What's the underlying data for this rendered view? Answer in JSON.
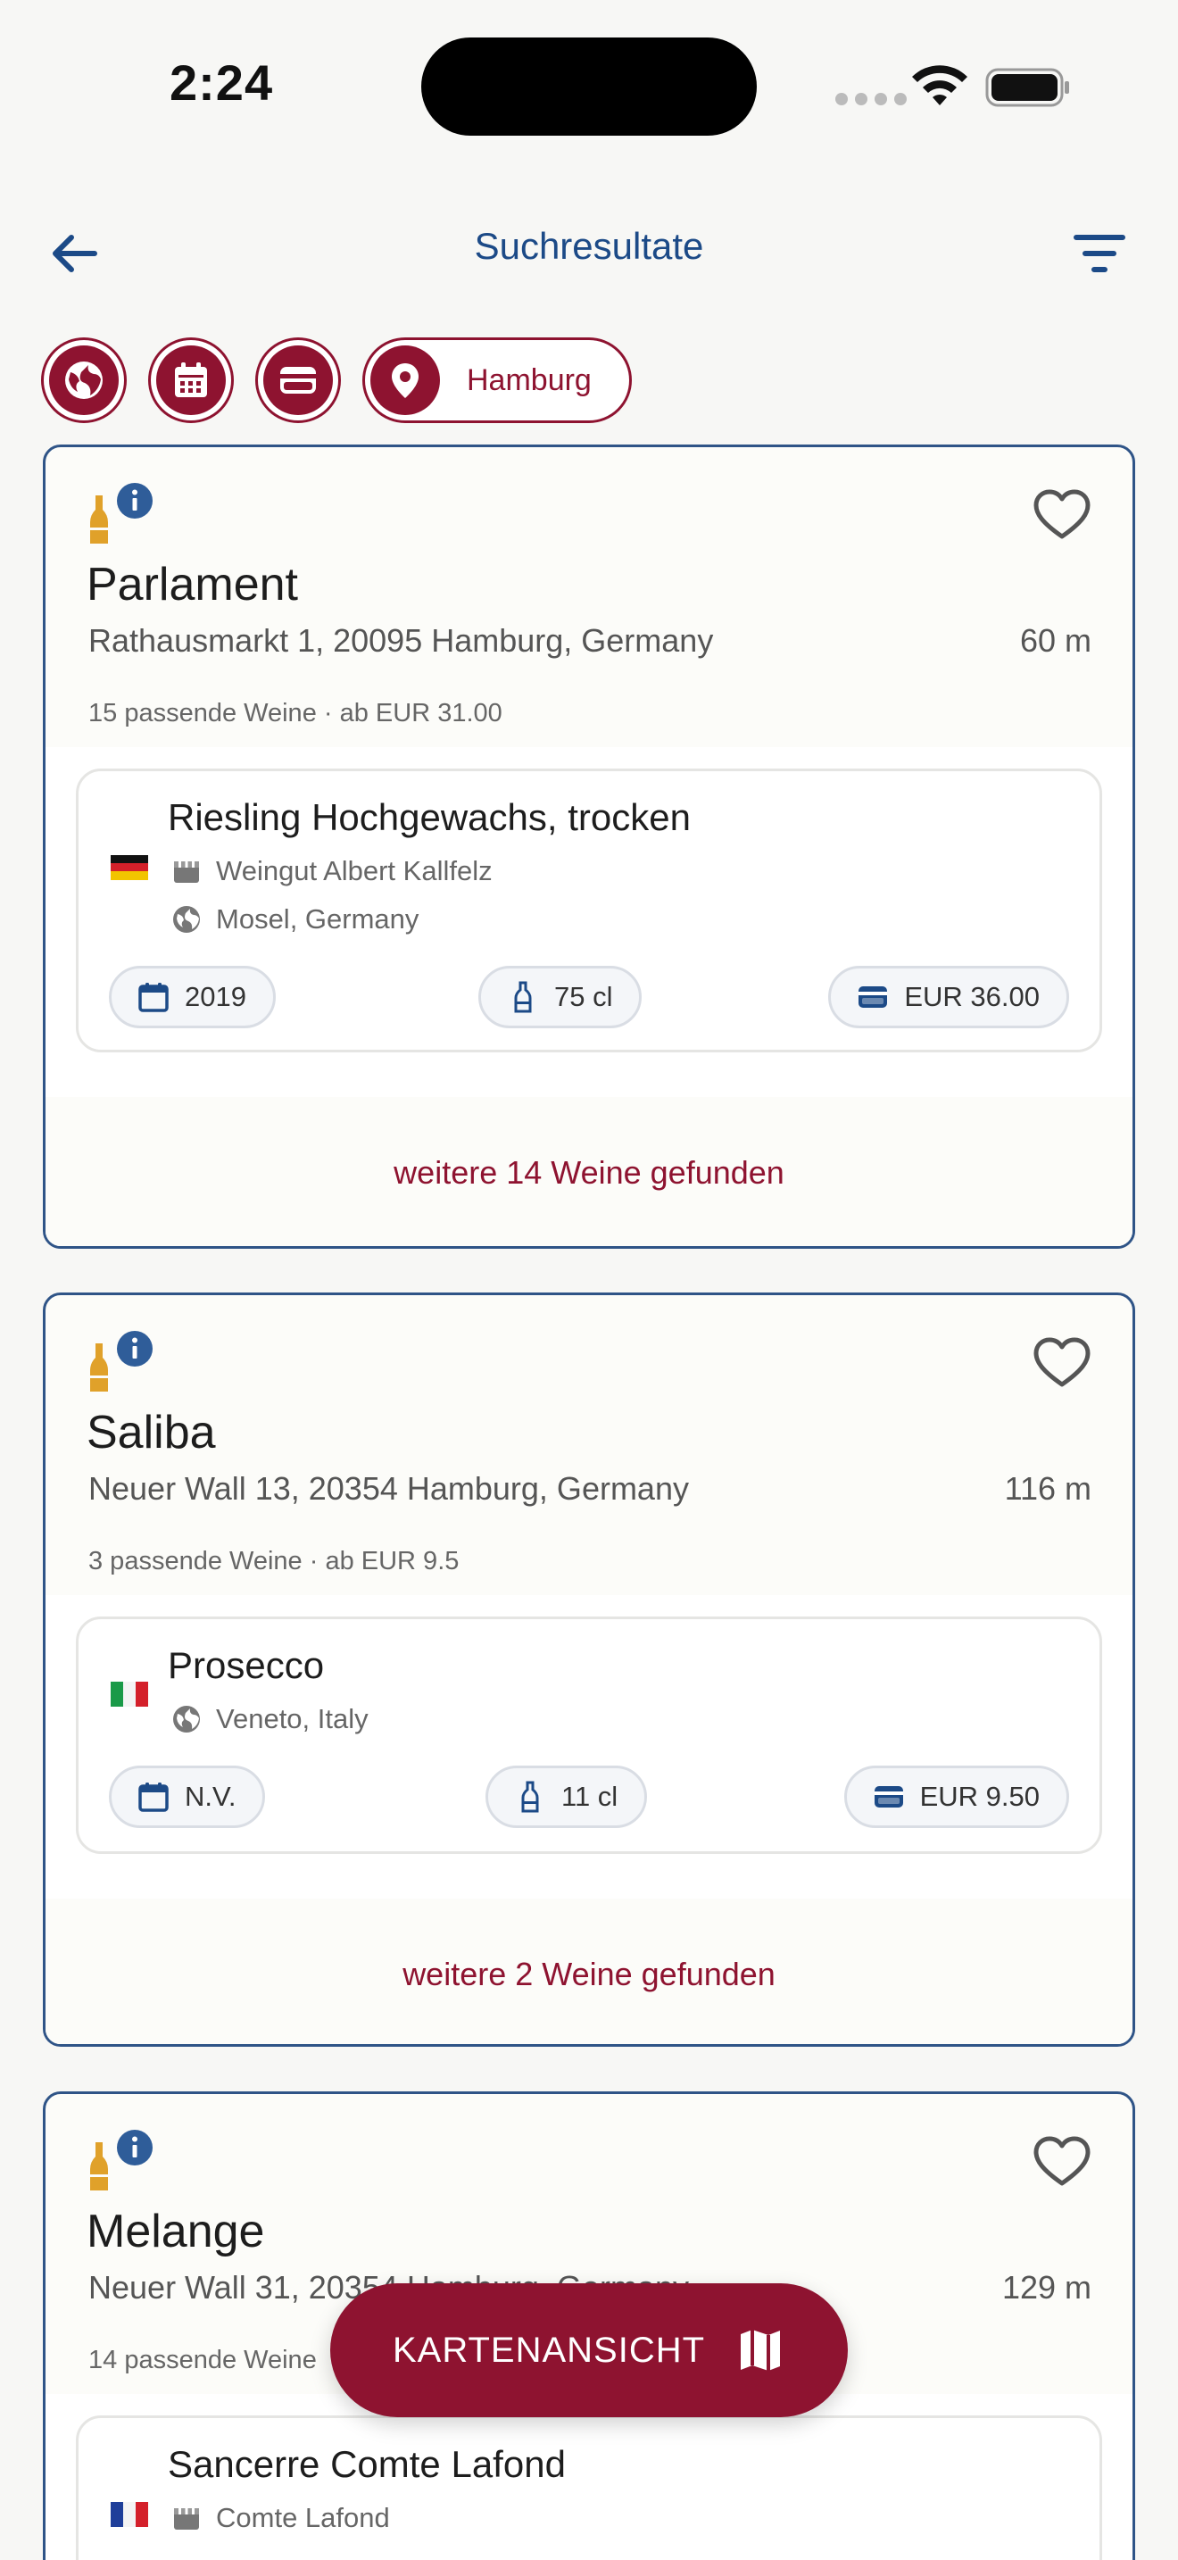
{
  "status_bar": {
    "time": "2:24"
  },
  "header": {
    "title": "Suchresultate"
  },
  "filters": {
    "location_label": "Hamburg"
  },
  "results": [
    {
      "name": "Parlament",
      "address": "Rathausmarkt 1, 20095 Hamburg, Germany",
      "distance": "60 m",
      "summary": "15 passende Weine · ab EUR 31.00",
      "wine": {
        "name": "Riesling Hochgewachs, trocken",
        "flag": "germany",
        "producer": "Weingut Albert Kallfelz",
        "region": "Mosel, Germany",
        "vintage": "2019",
        "volume": "75 cl",
        "price": "EUR 36.00"
      },
      "more_label": "weitere 14 Weine gefunden"
    },
    {
      "name": "Saliba",
      "address": "Neuer Wall 13, 20354 Hamburg, Germany",
      "distance": "116 m",
      "summary": "3 passende Weine · ab EUR 9.5",
      "wine": {
        "name": "Prosecco",
        "flag": "italy",
        "region": "Veneto, Italy",
        "vintage": "N.V.",
        "volume": "11 cl",
        "price": "EUR 9.50"
      },
      "more_label": "weitere 2 Weine gefunden"
    },
    {
      "name": "Melange",
      "address": "Neuer Wall 31, 20354 Hamburg, Germany",
      "distance": "129 m",
      "summary": "14 passende Weine",
      "wine": {
        "name": "Sancerre Comte Lafond",
        "flag": "france",
        "producer": "Comte Lafond"
      }
    }
  ],
  "fab": {
    "label": "KARTENANSICHT"
  },
  "colors": {
    "accent": "#8e1330",
    "brand_blue": "#1c4a87",
    "card_border": "#2f5487",
    "bottle": "#e0a12a"
  }
}
